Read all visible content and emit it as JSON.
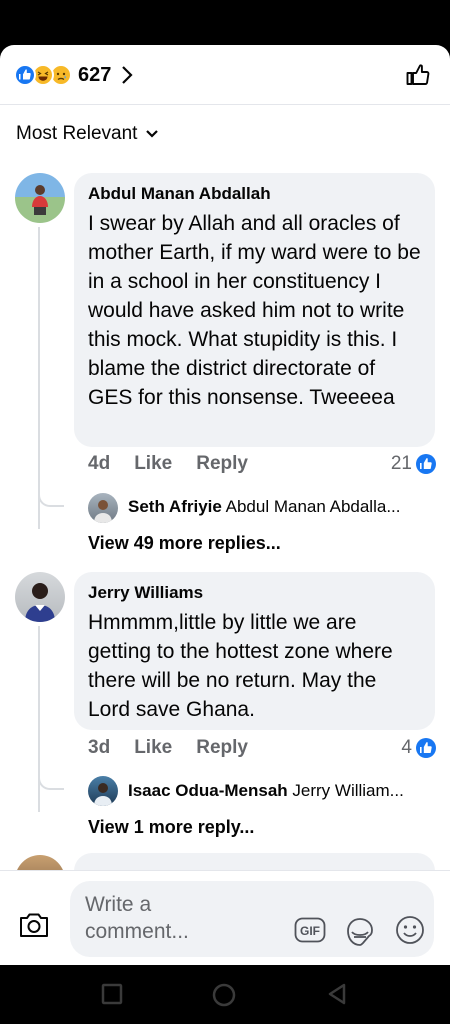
{
  "header": {
    "reaction_count": "627",
    "reactions": [
      "like-reaction",
      "haha-reaction",
      "sad-reaction"
    ]
  },
  "sort": {
    "label": "Most Relevant"
  },
  "comments": [
    {
      "author": "Abdul Manan Abdallah",
      "text": "I swear by Allah and all oracles of mother Earth, if my ward were to be in a school in her constituency I would have asked him not to write this mock. What stupidity is this. I blame the district directorate of GES for this nonsense. Tweeeea",
      "age": "4d",
      "like_label": "Like",
      "reply_label": "Reply",
      "like_count": "21",
      "reply_preview": {
        "author": "Seth Afriyie",
        "text": "Abdul Manan Abdalla..."
      },
      "more_replies": "View 49 more replies..."
    },
    {
      "author": "Jerry Williams",
      "text": "Hmmmm,little by little we are getting to the hottest zone where there will be no return. May the Lord save Ghana.",
      "age": "3d",
      "like_label": "Like",
      "reply_label": "Reply",
      "like_count": "4",
      "reply_preview": {
        "author": "Isaac Odua-Mensah",
        "text": "Jerry William..."
      },
      "more_replies": "View 1 more reply..."
    }
  ],
  "composer": {
    "placeholder": "Write a comment..."
  },
  "colors": {
    "accent": "#1877f2",
    "bubble": "#f0f2f5",
    "muted": "#65676b"
  }
}
